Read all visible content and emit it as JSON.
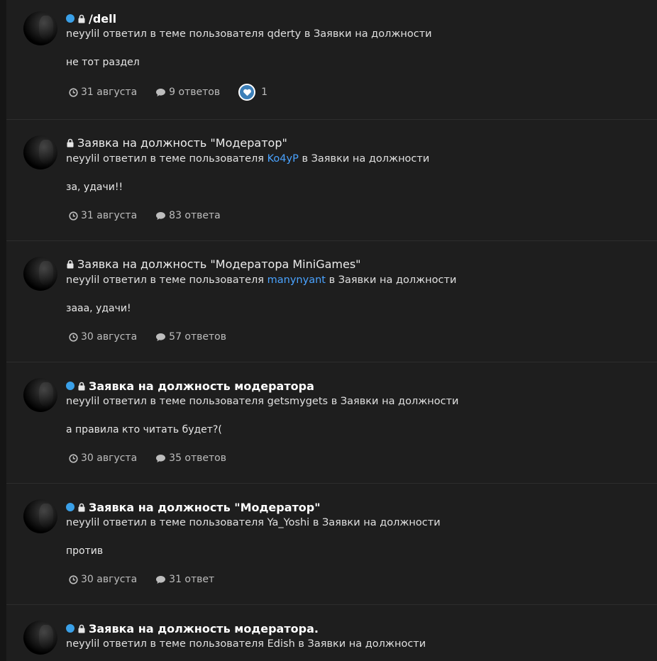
{
  "colors": {
    "background": "#1e1e1e",
    "unread_dot": "#3aa0e8",
    "link": "#4aa3ff",
    "reaction": "#3c7fb8"
  },
  "icons": {
    "clock": "clock-icon",
    "comment": "comment-icon",
    "lock": "lock-icon",
    "heart": "heart-icon"
  },
  "items": [
    {
      "unread": true,
      "locked": true,
      "title": "/dell",
      "meta_prefix": "neyylil ответил в теме пользователя",
      "author": "qderty",
      "meta_suffix": "в Заявки на должности",
      "snippet": "не тот раздел",
      "date": "31 августа",
      "replies": "9 ответов",
      "reaction_count": "1"
    },
    {
      "unread": false,
      "locked": true,
      "title": "Заявка на должность \"Модератор\"",
      "meta_prefix": "neyylil ответил в теме пользователя",
      "author": "Ko4yP",
      "meta_suffix": "в Заявки на должности",
      "snippet": "за, удачи!!",
      "date": "31 августа",
      "replies": "83 ответа"
    },
    {
      "unread": false,
      "locked": true,
      "title": "Заявка на должность \"Модератора MiniGames\"",
      "meta_prefix": "neyylil ответил в теме пользователя",
      "author": "manynyant",
      "meta_suffix": "в Заявки на должности",
      "snippet": "зааа, удачи!",
      "date": "30 августа",
      "replies": "57 ответов"
    },
    {
      "unread": true,
      "locked": true,
      "title": "Заявка на должность модератора",
      "meta_prefix": "neyylil ответил в теме пользователя",
      "author": "getsmygets",
      "meta_suffix": "в Заявки на должности",
      "snippet": "а правила кто читать будет?(",
      "date": "30 августа",
      "replies": "35 ответов"
    },
    {
      "unread": true,
      "locked": true,
      "title": "Заявка на должность \"Модератор\"",
      "meta_prefix": "neyylil ответил в теме пользователя",
      "author": "Ya_Yoshi",
      "meta_suffix": "в Заявки на должности",
      "snippet": "против",
      "date": "30 августа",
      "replies": "31 ответ"
    },
    {
      "unread": true,
      "locked": true,
      "title": "Заявка на должность модератора.",
      "meta_prefix": "neyylil ответил в теме пользователя",
      "author": "Edish",
      "meta_suffix": "в Заявки на должности"
    }
  ]
}
